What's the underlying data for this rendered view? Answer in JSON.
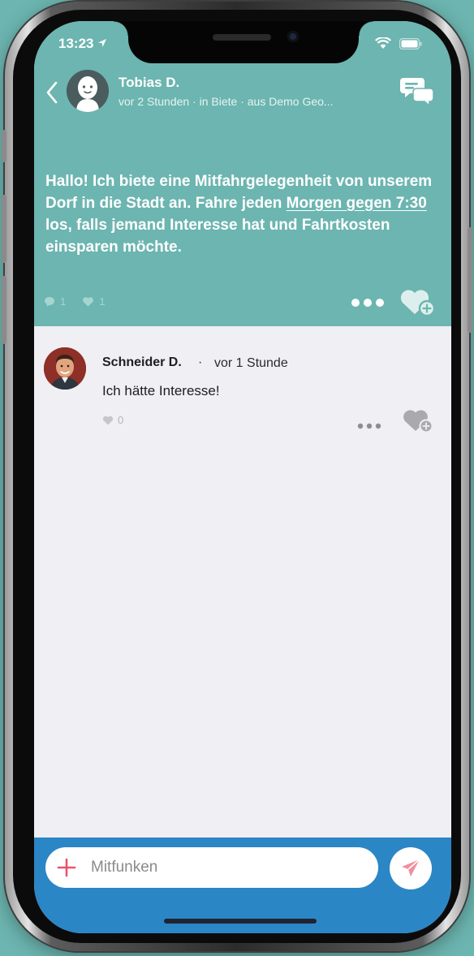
{
  "status_bar": {
    "time": "13:23",
    "icons": [
      "location-arrow-icon",
      "wifi-icon",
      "battery-icon"
    ]
  },
  "post": {
    "author_name": "Tobias D.",
    "author_meta": "vor 2 Stunden · in Biete · aus Demo Geo...",
    "text_before_link": "Hallo! Ich biete eine Mitfahrgelegenheit von unserem Dorf in die Stadt an. Fahre jeden ",
    "text_link": "Morgen gegen 7:30",
    "text_after_link": " los, falls jemand Interesse hat und Fahrtkosten einsparen möchte.",
    "comment_count": "1",
    "like_count": "1"
  },
  "comment": {
    "author_name": "Schneider D.",
    "separator": "·",
    "time": "vor 1 Stunde",
    "text": "Ich hätte Interesse!",
    "like_count": "0"
  },
  "composer": {
    "placeholder": "Mitfunken"
  },
  "colors": {
    "post_background": "#6cb5b0",
    "comment_background": "#f0eff4",
    "composer_background": "#2b86c6",
    "accent_pink": "#e8546b"
  }
}
